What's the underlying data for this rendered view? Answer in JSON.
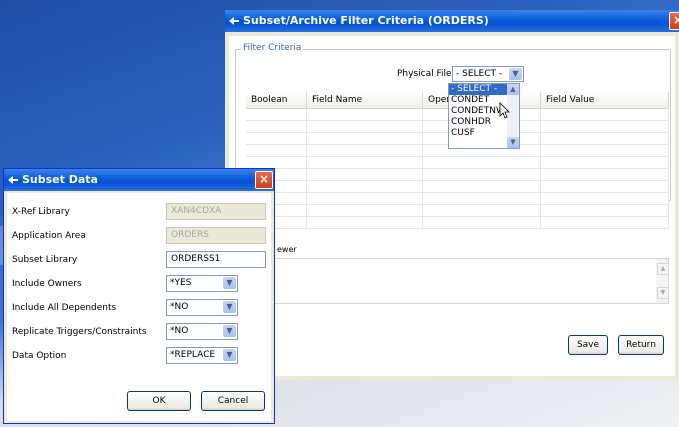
{
  "filter_window": {
    "title": "Subset/Archive Filter Criteria (ORDERS)",
    "group_label": "Filter Criteria",
    "physical_files_label": "Physical Files",
    "physical_files_value": "- SELECT -",
    "physical_files_options": [
      "- SELECT -",
      "CONDET",
      "CONDETNW",
      "CONHDR",
      "CUSF"
    ],
    "columns": [
      "Boolean",
      "Field Name",
      "Oper",
      "Field Value"
    ],
    "viewer_label": "ewer",
    "save_label": "Save",
    "return_label": "Return"
  },
  "subset_dialog": {
    "title": "Subset Data",
    "fields": [
      {
        "label": "X-Ref Library",
        "value": "XAN4CDXA"
      },
      {
        "label": "Application Area",
        "value": "ORDERS"
      },
      {
        "label": "Subset Library",
        "value": "ORDERSS1"
      },
      {
        "label": "Include Owners",
        "value": "*YES"
      },
      {
        "label": "Include All Dependents",
        "value": "*NO"
      },
      {
        "label": "Replicate Triggers/Constraints",
        "value": "*NO"
      },
      {
        "label": "Data Option",
        "value": "*REPLACE"
      }
    ],
    "ok_label": "OK",
    "cancel_label": "Cancel"
  }
}
